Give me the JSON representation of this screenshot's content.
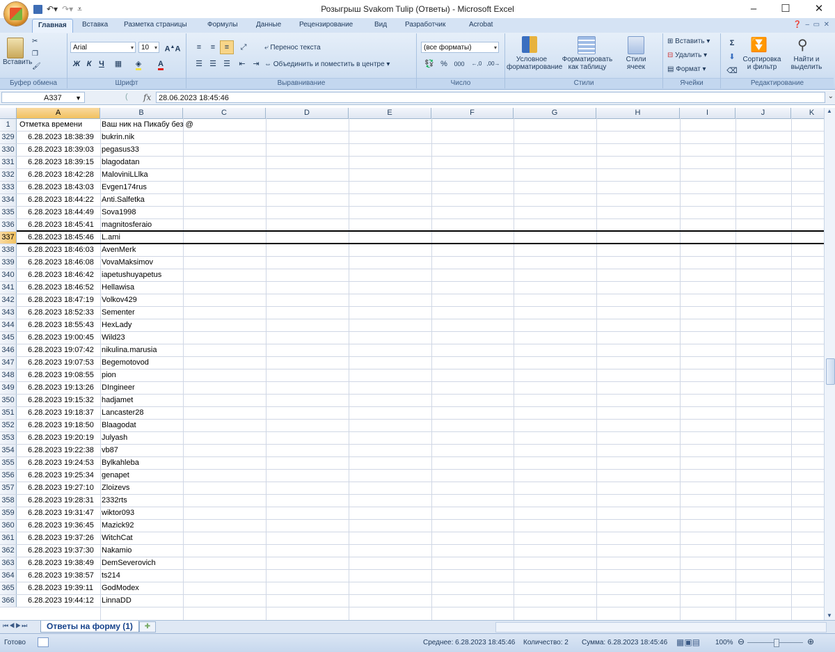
{
  "window": {
    "title": "Розыгрыш Svakom Tulip (Ответы) - Microsoft Excel"
  },
  "ribbon": {
    "tabs": [
      "Главная",
      "Вставка",
      "Разметка страницы",
      "Формулы",
      "Данные",
      "Рецензирование",
      "Вид",
      "Разработчик",
      "Acrobat"
    ],
    "active_tab": "Главная",
    "clipboard": {
      "paste": "Вставить",
      "label": "Буфер обмена"
    },
    "font": {
      "name": "Arial",
      "size": "10",
      "label": "Шрифт"
    },
    "alignment": {
      "wrap": "Перенос текста",
      "merge": "Объединить и поместить в центре",
      "label": "Выравнивание"
    },
    "number": {
      "format": "(все форматы)",
      "label": "Число"
    },
    "styles": {
      "conditional": "Условное форматирование",
      "as_table": "Форматировать как таблицу",
      "cell_styles": "Стили ячеек",
      "label": "Стили"
    },
    "cells": {
      "insert": "Вставить",
      "delete": "Удалить",
      "format": "Формат",
      "label": "Ячейки"
    },
    "editing": {
      "sort": "Сортировка и фильтр",
      "find": "Найти и выделить",
      "label": "Редактирование"
    }
  },
  "formula_bar": {
    "name_box": "A337",
    "fx": "fx",
    "value": "28.06.2023 18:45:46"
  },
  "sheet": {
    "columns": [
      "A",
      "B",
      "C",
      "D",
      "E",
      "F",
      "G",
      "H",
      "I",
      "J",
      "K"
    ],
    "selected_column": "A",
    "header_row": {
      "num": "1",
      "a": "Отметка времени",
      "b": "Ваш ник на Пикабу без @"
    },
    "selected_row": "337",
    "rows": [
      {
        "num": "329",
        "a": "6.28.2023 18:38:39",
        "b": "bukrin.nik"
      },
      {
        "num": "330",
        "a": "6.28.2023 18:39:03",
        "b": "pegasus33"
      },
      {
        "num": "331",
        "a": "6.28.2023 18:39:15",
        "b": "blagodatan"
      },
      {
        "num": "332",
        "a": "6.28.2023 18:42:28",
        "b": "MaloviniLLlka"
      },
      {
        "num": "333",
        "a": "6.28.2023 18:43:03",
        "b": "Evgen174rus"
      },
      {
        "num": "334",
        "a": "6.28.2023 18:44:22",
        "b": "Anti.Salfetka"
      },
      {
        "num": "335",
        "a": "6.28.2023 18:44:49",
        "b": "Sova1998"
      },
      {
        "num": "336",
        "a": "6.28.2023 18:45:41",
        "b": "magnitosferaio"
      },
      {
        "num": "337",
        "a": "6.28.2023 18:45:46",
        "b": "L.ami"
      },
      {
        "num": "338",
        "a": "6.28.2023 18:46:03",
        "b": "AvenMerk"
      },
      {
        "num": "339",
        "a": "6.28.2023 18:46:08",
        "b": "VovaMaksimov"
      },
      {
        "num": "340",
        "a": "6.28.2023 18:46:42",
        "b": "iapetushuyapetus"
      },
      {
        "num": "341",
        "a": "6.28.2023 18:46:52",
        "b": "Hellawisa"
      },
      {
        "num": "342",
        "a": "6.28.2023 18:47:19",
        "b": "Volkov429"
      },
      {
        "num": "343",
        "a": "6.28.2023 18:52:33",
        "b": "Sementer"
      },
      {
        "num": "344",
        "a": "6.28.2023 18:55:43",
        "b": "HexLady"
      },
      {
        "num": "345",
        "a": "6.28.2023 19:00:45",
        "b": "Wild23"
      },
      {
        "num": "346",
        "a": "6.28.2023 19:07:42",
        "b": "nikulina.marusia"
      },
      {
        "num": "347",
        "a": "6.28.2023 19:07:53",
        "b": "Begemotovod"
      },
      {
        "num": "348",
        "a": "6.28.2023 19:08:55",
        "b": "pion"
      },
      {
        "num": "349",
        "a": "6.28.2023 19:13:26",
        "b": "DIngineer"
      },
      {
        "num": "350",
        "a": "6.28.2023 19:15:32",
        "b": "hadjamet"
      },
      {
        "num": "351",
        "a": "6.28.2023 19:18:37",
        "b": "Lancaster28"
      },
      {
        "num": "352",
        "a": "6.28.2023 19:18:50",
        "b": "Blaagodat"
      },
      {
        "num": "353",
        "a": "6.28.2023 19:20:19",
        "b": "Julyash"
      },
      {
        "num": "354",
        "a": "6.28.2023 19:22:38",
        "b": "vb87"
      },
      {
        "num": "355",
        "a": "6.28.2023 19:24:53",
        "b": "Bylkahleba"
      },
      {
        "num": "356",
        "a": "6.28.2023 19:25:34",
        "b": "genapet"
      },
      {
        "num": "357",
        "a": "6.28.2023 19:27:10",
        "b": "Zloizevs"
      },
      {
        "num": "358",
        "a": "6.28.2023 19:28:31",
        "b": "2332rts"
      },
      {
        "num": "359",
        "a": "6.28.2023 19:31:47",
        "b": "wiktor093"
      },
      {
        "num": "360",
        "a": "6.28.2023 19:36:45",
        "b": "Mazick92"
      },
      {
        "num": "361",
        "a": "6.28.2023 19:37:26",
        "b": "WitchCat"
      },
      {
        "num": "362",
        "a": "6.28.2023 19:37:30",
        "b": "Nakamio"
      },
      {
        "num": "363",
        "a": "6.28.2023 19:38:49",
        "b": "DemSeverovich"
      },
      {
        "num": "364",
        "a": "6.28.2023 19:38:57",
        "b": "ts214"
      },
      {
        "num": "365",
        "a": "6.28.2023 19:39:11",
        "b": "GodModex"
      }
    ],
    "partial_row": {
      "num": "366",
      "a": "6.28.2023 19:44:12",
      "b": "LinnaDD"
    }
  },
  "sheet_tab": "Ответы на форму (1)",
  "status": {
    "ready": "Готово",
    "average": "Среднее: 6.28.2023 18:45:46",
    "count": "Количество: 2",
    "sum": "Сумма: 6.28.2023 18:45:46",
    "zoom": "100%"
  }
}
